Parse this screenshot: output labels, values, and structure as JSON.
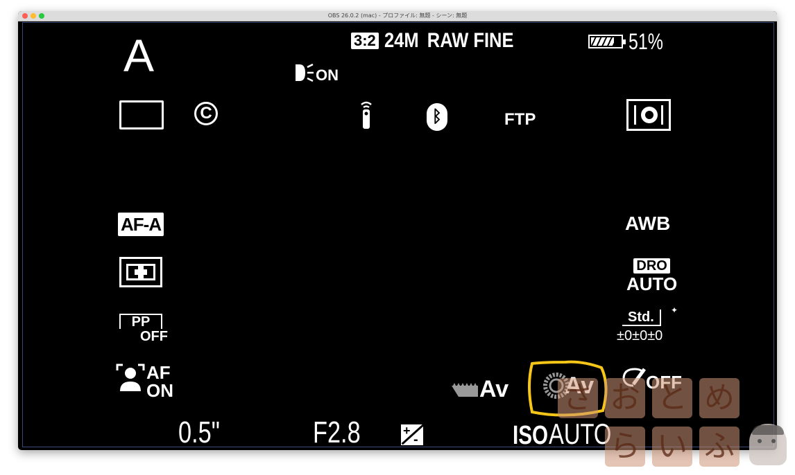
{
  "window": {
    "title": "OBS 26.0.2 (mac) - プロファイル: 無題 - シーン: 無題"
  },
  "camera": {
    "mode": "A",
    "aspect": "3:2",
    "image_size": "24M",
    "quality": "RAW FINE",
    "battery_percent": "51%",
    "battery_level": 0.51,
    "flash_status": "ON",
    "ftp": "FTP",
    "focus_mode": "AF-A",
    "white_balance": "AWB",
    "dro": "DRO",
    "dro_value": "AUTO",
    "creative_style": "Std.",
    "creative_style_values": "±0±0±0",
    "picture_profile": "PP",
    "picture_profile_state": "OFF",
    "face_af_label": "AF",
    "face_af_state": "ON",
    "dial_left_label": "Av",
    "dial_right_label": "Av",
    "soft_skin_state": "OFF",
    "shutter": "0.5\"",
    "aperture": "F2.8",
    "iso_label": "ISO",
    "iso_value": "AUTO",
    "highlight_color": "#f5c518"
  },
  "watermark": {
    "row1": [
      "さ",
      "お",
      "と",
      "め"
    ],
    "row2": [
      "ら",
      "い",
      "ふ"
    ]
  }
}
